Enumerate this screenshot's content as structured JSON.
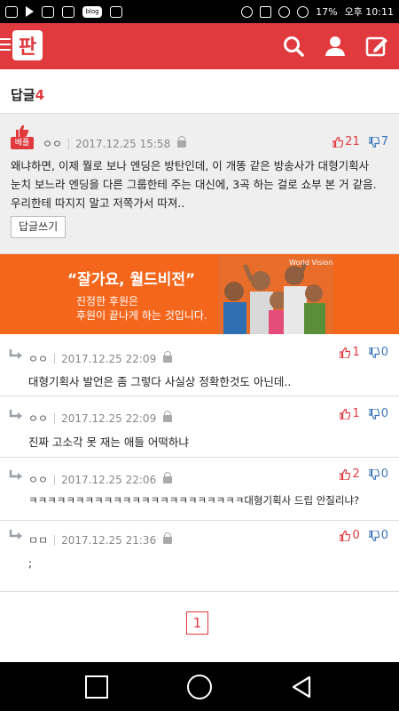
{
  "status_bar": {
    "battery": "17%",
    "time": "오후 10:11",
    "blog_badge": "blog"
  },
  "app": {
    "logo_text": "판",
    "icons": [
      "menu-icon",
      "search-icon",
      "user-icon",
      "edit-icon"
    ],
    "accent_color": "#e0393e"
  },
  "replies_header": {
    "label": "답글",
    "count": "4"
  },
  "best_comment": {
    "badge": "베플",
    "author": "ㅇㅇ",
    "date": "2017.12.25 15:58",
    "up": "21",
    "down": "7",
    "text": "왜냐하면, 이제 뭘로 보나 엔딩은 방탄인데, 이 개똥 같은 방송사가 대형기획사 눈치 보느라 엔딩을 다른 그룹한테 주는 대신에, 3곡 하는 걸로 쇼부 본 거 같음. 우리한테 따지지 말고 저쪽가서 따져..",
    "reply_button": "답글쓰기"
  },
  "ad": {
    "headline": "“잘가요, 월드비전”",
    "line1": "진정한 후원은",
    "line2": "후원이 끝나게 하는 것입니다.",
    "brand": "World Vision"
  },
  "replies": [
    {
      "author": "ㅇㅇ",
      "date": "2017.12.25 22:09",
      "up": "1",
      "down": "0",
      "text": "대형기획사 발언은 좀 그렇다 사실상 정확한것도 아닌데.."
    },
    {
      "author": "ㅇㅇ",
      "date": "2017.12.25 22:09",
      "up": "1",
      "down": "0",
      "text": "진짜 고소각 못 재는 애들 어떡하냐"
    },
    {
      "author": "ㅇㅇ",
      "date": "2017.12.25 22:06",
      "up": "2",
      "down": "0",
      "text": "ㅋㅋㅋㅋㅋㅋㅋㅋㅋㅋㅋㅋㅋㅋㅋㅋㅋㅋㅋㅋㅋㅋㅋ대형기획사 드립 안질리냐?"
    },
    {
      "author": "ㅁㅁ",
      "date": "2017.12.25 21:36",
      "up": "0",
      "down": "0",
      "text": ";"
    }
  ],
  "pagination": {
    "current": "1"
  }
}
